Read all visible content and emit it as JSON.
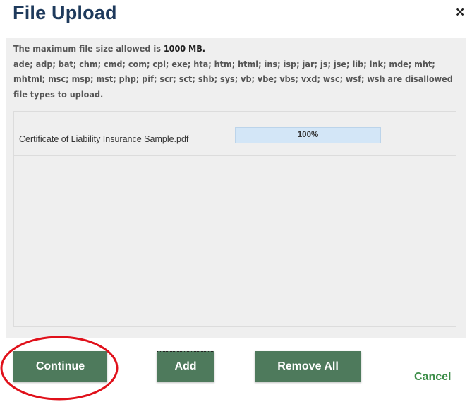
{
  "dialog": {
    "title": "File Upload",
    "close_glyph": "×"
  },
  "info": {
    "max_size_prefix": "The maximum file size allowed is ",
    "max_size_value": "1000 MB.",
    "disallowed_text": "ade; adp; bat; chm; cmd; com; cpl; exe; hta; htm; html; ins; isp; jar; js; jse; lib; lnk; mde; mht; mhtml; msc; msp; mst; php; pif; scr; sct; shb; sys; vb; vbe; vbs; vxd; wsc; wsf; wsh are disallowed file types to upload."
  },
  "files": [
    {
      "name": "Certificate of Liability Insurance Sample.pdf",
      "progress_label": "100%",
      "progress_fraction": 1.0
    }
  ],
  "buttons": {
    "continue_label": "Continue",
    "add_label": "Add",
    "remove_all_label": "Remove All",
    "cancel_label": "Cancel"
  },
  "colors": {
    "title": "#1e3a5c",
    "button_bg": "#4e7a5c",
    "cancel_link": "#3c8d48",
    "highlight_ring": "#e0101a",
    "progress_fill": "#d3e6f7"
  }
}
